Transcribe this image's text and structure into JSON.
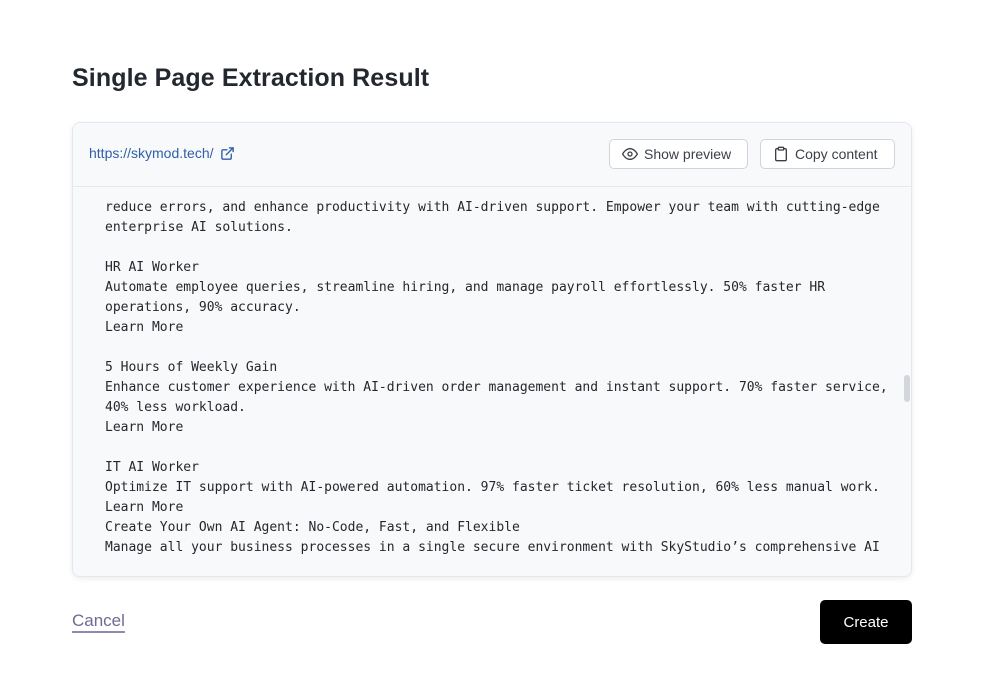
{
  "page": {
    "title": "Single Page Extraction Result"
  },
  "source": {
    "url": "https://skymod.tech/",
    "external_link_icon": "external-link-icon"
  },
  "toolbar": {
    "show_preview_label": "Show preview",
    "show_preview_icon": "eye-icon",
    "copy_content_label": "Copy content",
    "copy_content_icon": "clipboard-icon"
  },
  "content": {
    "text": "reduce errors, and enhance productivity with AI-driven support. Empower your team with cutting-edge\nenterprise AI solutions.\n\nHR AI Worker\nAutomate employee queries, streamline hiring, and manage payroll effortlessly. 50% faster HR\noperations, 90% accuracy.\nLearn More\n\n5 Hours of Weekly Gain\nEnhance customer experience with AI-driven order management and instant support. 70% faster service,\n40% less workload.\nLearn More\n\nIT AI Worker\nOptimize IT support with AI-powered automation. 97% faster ticket resolution, 60% less manual work.\nLearn More\nCreate Your Own AI Agent: No-Code, Fast, and Flexible\nManage all your business processes in a single secure environment with SkyStudio’s comprehensive AI"
  },
  "footer": {
    "cancel_label": "Cancel",
    "create_label": "Create"
  },
  "colors": {
    "link": "#2f5fa8",
    "create_button_bg": "#000000",
    "cancel_link": "#6f6a94",
    "content_bg": "#f8f9fb"
  }
}
